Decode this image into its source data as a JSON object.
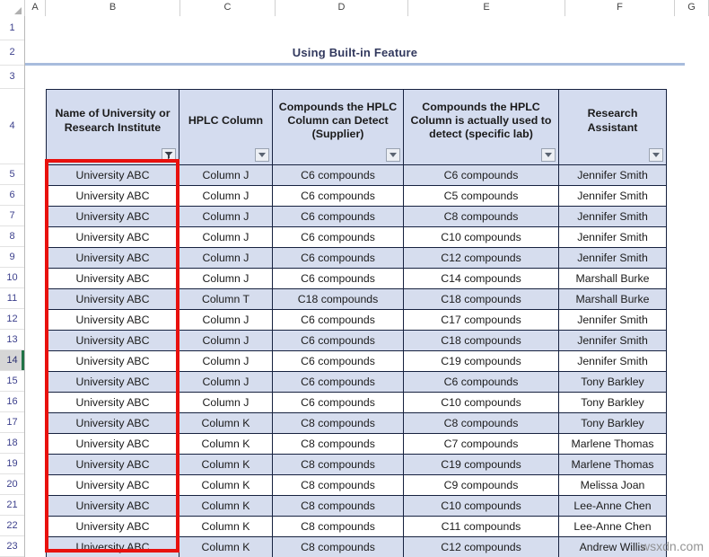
{
  "spreadsheet": {
    "column_letters": [
      "A",
      "B",
      "C",
      "D",
      "E",
      "F",
      "G"
    ],
    "row_numbers": [
      "1",
      "2",
      "3",
      "4",
      "5",
      "6",
      "7",
      "8",
      "9",
      "10",
      "11",
      "12",
      "13",
      "14",
      "15",
      "16",
      "17",
      "18",
      "19",
      "20",
      "21",
      "22",
      "23"
    ],
    "active_row": "14",
    "watermark": "wsxdn.com"
  },
  "title": {
    "text": "Using Built-in Feature"
  },
  "table": {
    "headers": [
      {
        "label": "Name of University or Research Institute",
        "filter_icon": "filter-applied-icon"
      },
      {
        "label": "HPLC Column",
        "filter_icon": "chevron-down-icon"
      },
      {
        "label": "Compounds the HPLC Column can Detect (Supplier)",
        "filter_icon": "chevron-down-icon"
      },
      {
        "label": "Compounds the HPLC Column is actually used to detect (specific lab)",
        "filter_icon": "chevron-down-icon"
      },
      {
        "label": "Research Assistant",
        "filter_icon": "chevron-down-icon"
      }
    ],
    "rows": [
      {
        "row": "5",
        "institute": "University ABC",
        "hplc_column": "Column J",
        "supplier_detect": "C6 compounds",
        "lab_detect": "C6 compounds",
        "assistant": "Jennifer Smith"
      },
      {
        "row": "6",
        "institute": "University ABC",
        "hplc_column": "Column J",
        "supplier_detect": "C6 compounds",
        "lab_detect": "C5 compounds",
        "assistant": "Jennifer Smith"
      },
      {
        "row": "7",
        "institute": "University ABC",
        "hplc_column": "Column J",
        "supplier_detect": "C6 compounds",
        "lab_detect": "C8 compounds",
        "assistant": "Jennifer Smith"
      },
      {
        "row": "8",
        "institute": "University ABC",
        "hplc_column": "Column J",
        "supplier_detect": "C6 compounds",
        "lab_detect": "C10 compounds",
        "assistant": "Jennifer Smith"
      },
      {
        "row": "9",
        "institute": "University ABC",
        "hplc_column": "Column J",
        "supplier_detect": "C6 compounds",
        "lab_detect": "C12 compounds",
        "assistant": "Jennifer Smith"
      },
      {
        "row": "10",
        "institute": "University ABC",
        "hplc_column": "Column J",
        "supplier_detect": "C6 compounds",
        "lab_detect": "C14 compounds",
        "assistant": "Marshall Burke"
      },
      {
        "row": "11",
        "institute": "University ABC",
        "hplc_column": "Column T",
        "supplier_detect": "C18 compounds",
        "lab_detect": "C18 compounds",
        "assistant": "Marshall Burke"
      },
      {
        "row": "12",
        "institute": "University ABC",
        "hplc_column": "Column J",
        "supplier_detect": "C6 compounds",
        "lab_detect": "C17 compounds",
        "assistant": "Jennifer Smith"
      },
      {
        "row": "13",
        "institute": "University ABC",
        "hplc_column": "Column J",
        "supplier_detect": "C6 compounds",
        "lab_detect": "C18 compounds",
        "assistant": "Jennifer Smith"
      },
      {
        "row": "14",
        "institute": "University ABC",
        "hplc_column": "Column J",
        "supplier_detect": "C6 compounds",
        "lab_detect": "C19 compounds",
        "assistant": "Jennifer Smith"
      },
      {
        "row": "15",
        "institute": "University ABC",
        "hplc_column": "Column J",
        "supplier_detect": "C6 compounds",
        "lab_detect": "C6 compounds",
        "assistant": "Tony Barkley"
      },
      {
        "row": "16",
        "institute": "University ABC",
        "hplc_column": "Column J",
        "supplier_detect": "C6 compounds",
        "lab_detect": "C10 compounds",
        "assistant": "Tony Barkley"
      },
      {
        "row": "17",
        "institute": "University ABC",
        "hplc_column": "Column K",
        "supplier_detect": "C8 compounds",
        "lab_detect": "C8 compounds",
        "assistant": "Tony Barkley"
      },
      {
        "row": "18",
        "institute": "University ABC",
        "hplc_column": "Column K",
        "supplier_detect": "C8 compounds",
        "lab_detect": "C7 compounds",
        "assistant": "Marlene Thomas"
      },
      {
        "row": "19",
        "institute": "University ABC",
        "hplc_column": "Column K",
        "supplier_detect": "C8 compounds",
        "lab_detect": "C19 compounds",
        "assistant": "Marlene Thomas"
      },
      {
        "row": "20",
        "institute": "University ABC",
        "hplc_column": "Column K",
        "supplier_detect": "C8 compounds",
        "lab_detect": "C9 compounds",
        "assistant": "Melissa Joan"
      },
      {
        "row": "21",
        "institute": "University ABC",
        "hplc_column": "Column K",
        "supplier_detect": "C8 compounds",
        "lab_detect": "C10 compounds",
        "assistant": "Lee-Anne Chen"
      },
      {
        "row": "22",
        "institute": "University ABC",
        "hplc_column": "Column K",
        "supplier_detect": "C8 compounds",
        "lab_detect": "C11 compounds",
        "assistant": "Lee-Anne Chen"
      },
      {
        "row": "23",
        "institute": "University ABC",
        "hplc_column": "Column K",
        "supplier_detect": "C8 compounds",
        "lab_detect": "C12 compounds",
        "assistant": "Andrew Willis"
      }
    ]
  },
  "colors": {
    "header_fill": "#d4dcef",
    "band_fill": "#d6ddee",
    "grid_border": "#16213f",
    "highlight_box": "#e8110e",
    "title_rule": "#a8bcdd",
    "title_text": "#32395e"
  }
}
